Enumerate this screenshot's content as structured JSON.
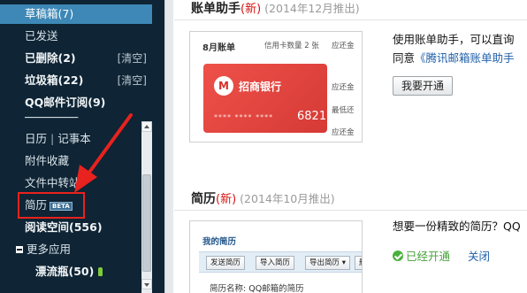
{
  "sidebar": {
    "items": [
      {
        "label": "草稿箱",
        "count": "(7)",
        "style": "active"
      },
      {
        "label": "已发送"
      },
      {
        "label": "已删除",
        "count": "(2)",
        "action": "[清空]",
        "style": "bold"
      },
      {
        "label": "垃圾箱",
        "count": "(22)",
        "action": "[清空]",
        "style": "bold"
      },
      {
        "label": "QQ邮件订阅",
        "count": "(9)",
        "style": "bold"
      },
      {
        "label": "日历",
        "separator": "|",
        "label2": "记事本"
      },
      {
        "label": "附件收藏"
      },
      {
        "label": "文件中转站"
      },
      {
        "label": "简历",
        "badge": "BETA"
      },
      {
        "label": "阅读空间",
        "count": "(556)",
        "style": "bold"
      },
      {
        "label": "更多应用",
        "style": "group"
      },
      {
        "label": "漂流瓶",
        "count": "(50)",
        "style": "bold"
      }
    ]
  },
  "sections": [
    {
      "title": "账单助手",
      "new_tag": "(新)",
      "date": "(2014年12月推出)",
      "preview": {
        "heading": "8月账单",
        "cards_label": "信用卡数量 2 张",
        "due_label_1": "应还金",
        "bank_logo": "M",
        "bank_name": "招商银行",
        "card_mask": "**** **** ****",
        "card_last4": "6821",
        "due_label_2": "应还金",
        "min_label": "最低还",
        "due_label_3": "应还金"
      },
      "description_line1": "使用账单助手，可以直询",
      "description_line2_prefix": "同意",
      "description_link": "《腾讯邮箱账单助手",
      "button_label": "我要开通"
    },
    {
      "title": "简历",
      "new_tag": "(新)",
      "date": "(2014年10月推出)",
      "preview": {
        "heading": "我的简历",
        "buttons": [
          "发送简历",
          "导入简历",
          "导出简历 ▾",
          "删"
        ],
        "resume_name": "简历名称:  QQ邮箱的简历"
      },
      "description_line1": "想要一份精致的简历？QQ",
      "status_text": "已经开通",
      "close_link": "关闭"
    }
  ],
  "colors": {
    "sidebar_bg": "#0f2434",
    "active_item": "#3d88b6",
    "annotation_red": "#e8221e",
    "new_tag_red": "#d3140f",
    "link_blue": "#1f5fa8",
    "status_green": "#49a13c"
  }
}
